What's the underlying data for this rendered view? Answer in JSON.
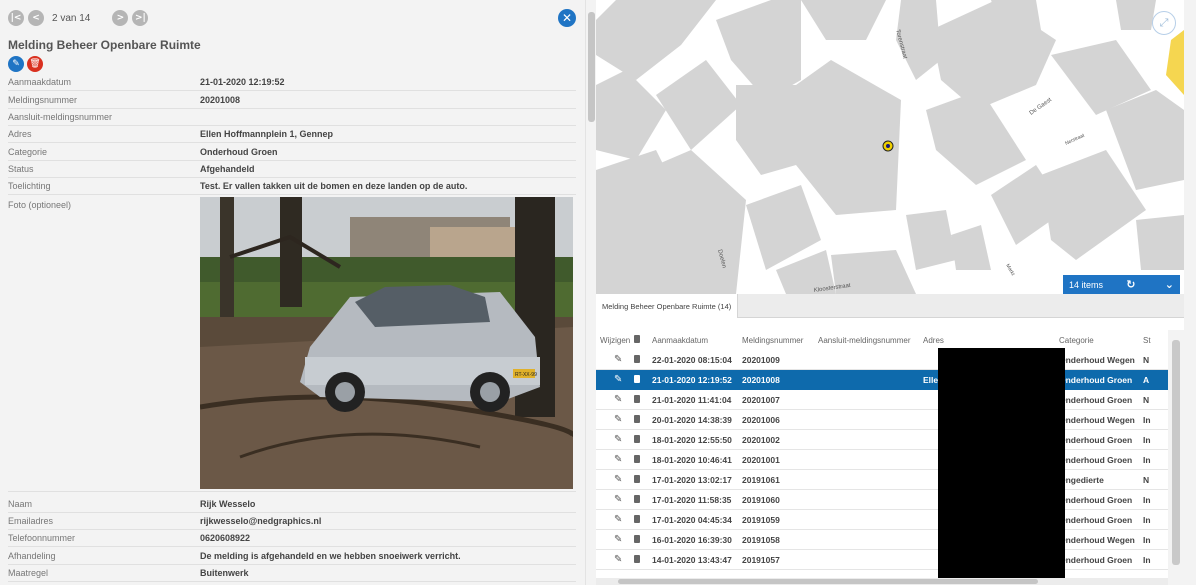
{
  "detail": {
    "nav_text": "2 van 14",
    "title": "Melding Beheer Openbare Ruimte",
    "fields": [
      {
        "label": "Aanmaakdatum",
        "value": "21-01-2020 12:19:52"
      },
      {
        "label": "Meldingsnummer",
        "value": "20201008"
      },
      {
        "label": "Aansluit-meldingsnummer",
        "value": ""
      },
      {
        "label": "Adres",
        "value": "Ellen Hoffmannplein 1, Gennep"
      },
      {
        "label": "Categorie",
        "value": "Onderhoud Groen"
      },
      {
        "label": "Status",
        "value": "Afgehandeld"
      },
      {
        "label": "Toelichting",
        "value": "Test. Er vallen takken uit de bomen en deze landen op de auto."
      }
    ],
    "photo_label": "Foto (optioneel)",
    "photo_plate": "RT-XX-99",
    "fields_after": [
      {
        "label": "Naam",
        "value": "Rijk Wesselo"
      },
      {
        "label": "Emailadres",
        "value": "rijkwesselo@nedgraphics.nl"
      },
      {
        "label": "Telefoonnummer",
        "value": "0620608922"
      },
      {
        "label": "Afhandeling",
        "value": "De melding is afgehandeld en we hebben snoeiwerk verricht."
      },
      {
        "label": "Maatregel",
        "value": "Buitenwerk"
      }
    ]
  },
  "map": {
    "streets": [
      "Torenstraat",
      "De Gaest",
      "Nerstraat",
      "Doelen",
      "Kloosterstraat",
      "Markt"
    ],
    "marker_label": "1",
    "items_count": "14 items"
  },
  "table": {
    "tab_label": "Melding Beheer Openbare Ruimte (14)",
    "headers": [
      "Wijzigen",
      "Aanmaakdatum",
      "Meldingsnummer",
      "Aansluit-meldingsnummer",
      "Adres",
      "Categorie",
      "St"
    ],
    "rows": [
      {
        "date": "22-01-2020 08:15:04",
        "nr": "20201009",
        "adres": "",
        "cat": "Onderhoud Wegen",
        "st": "N"
      },
      {
        "date": "21-01-2020 12:19:52",
        "nr": "20201008",
        "adres": "Ellen Hoffmannplein 1, Gennep",
        "cat": "Onderhoud Groen",
        "st": "A",
        "selected": true
      },
      {
        "date": "21-01-2020 11:41:04",
        "nr": "20201007",
        "adres": "",
        "cat": "Onderhoud Groen",
        "st": "N"
      },
      {
        "date": "20-01-2020 14:38:39",
        "nr": "20201006",
        "adres": "",
        "cat": "Onderhoud Wegen",
        "st": "In"
      },
      {
        "date": "18-01-2020 12:55:50",
        "nr": "20201002",
        "adres": "",
        "cat": "Onderhoud Groen",
        "st": "In"
      },
      {
        "date": "18-01-2020 10:46:41",
        "nr": "20201001",
        "adres": "",
        "cat": "Onderhoud Groen",
        "st": "In"
      },
      {
        "date": "17-01-2020 13:02:17",
        "nr": "20191061",
        "adres": "",
        "cat": "Ongedierte",
        "st": "N"
      },
      {
        "date": "17-01-2020 11:58:35",
        "nr": "20191060",
        "adres": "",
        "cat": "Onderhoud Groen",
        "st": "In"
      },
      {
        "date": "17-01-2020 04:45:34",
        "nr": "20191059",
        "adres": "",
        "cat": "Onderhoud Groen",
        "st": "In"
      },
      {
        "date": "16-01-2020 16:39:30",
        "nr": "20191058",
        "adres": "",
        "cat": "Onderhoud Wegen",
        "st": "In"
      },
      {
        "date": "14-01-2020 13:43:47",
        "nr": "20191057",
        "adres": "",
        "cat": "Onderhoud Groen",
        "st": "In"
      }
    ]
  }
}
